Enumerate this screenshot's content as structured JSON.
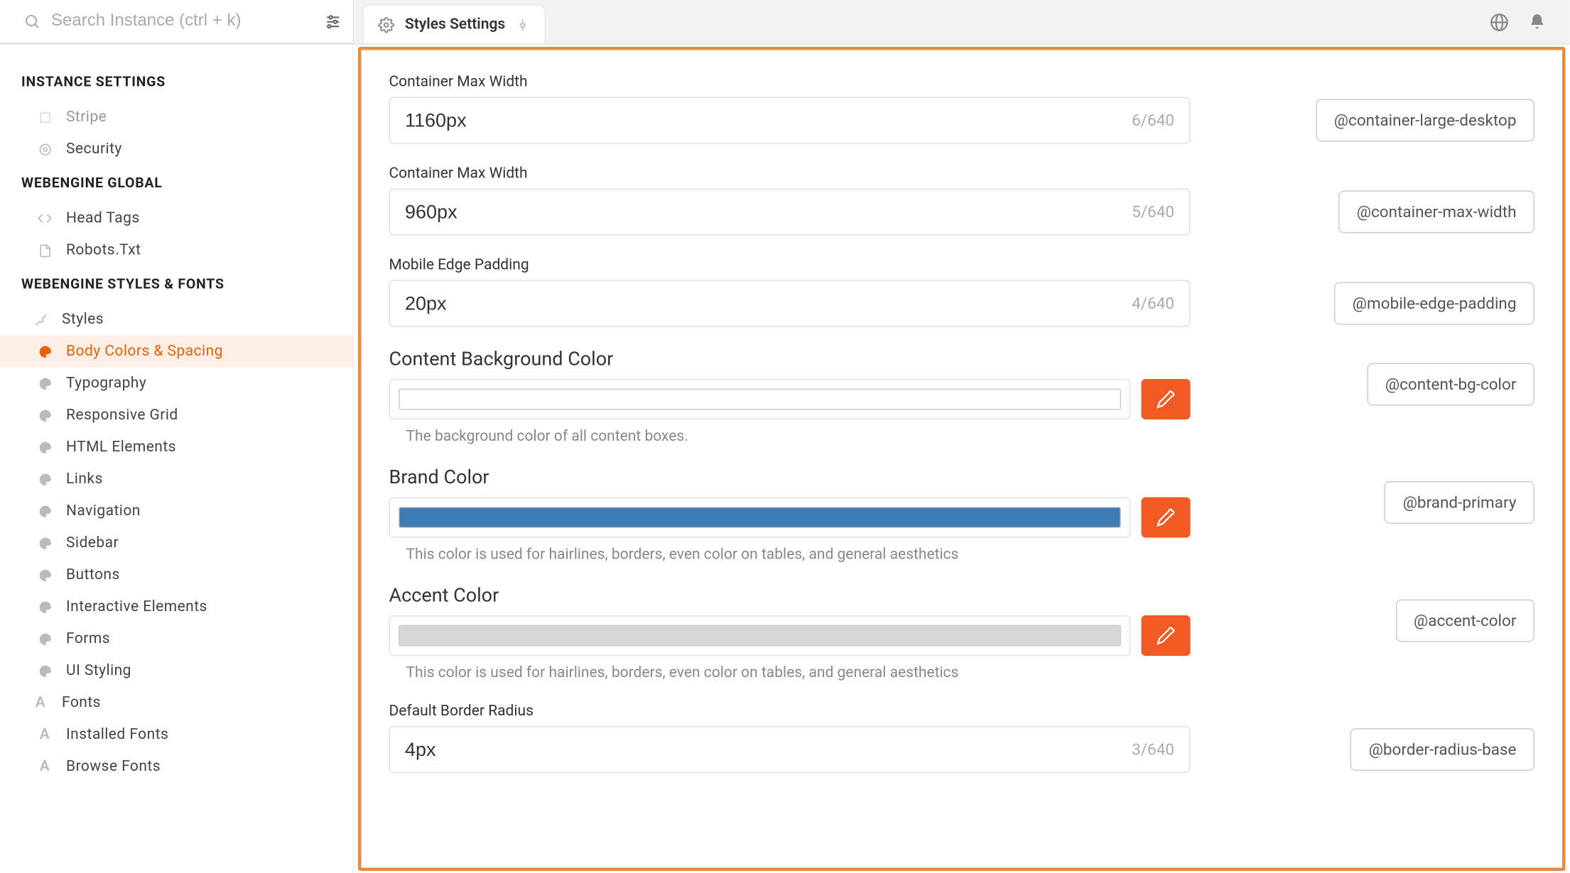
{
  "search": {
    "placeholder": "Search Instance (ctrl + k)"
  },
  "tab": {
    "label": "Styles Settings"
  },
  "sidebar": {
    "sectionA": "INSTANCE SETTINGS",
    "itemsA": [
      {
        "label": "Stripe"
      },
      {
        "label": "Security"
      }
    ],
    "sectionB": "WEBENGINE GLOBAL",
    "itemsB": [
      {
        "label": "Head Tags"
      },
      {
        "label": "Robots.Txt"
      }
    ],
    "sectionC": "WEBENGINE STYLES & FONTS",
    "stylesLabel": "Styles",
    "styleSub": [
      {
        "label": "Body Colors & Spacing",
        "active": true
      },
      {
        "label": "Typography"
      },
      {
        "label": "Responsive Grid"
      },
      {
        "label": "HTML Elements"
      },
      {
        "label": "Links"
      },
      {
        "label": "Navigation"
      },
      {
        "label": "Sidebar"
      },
      {
        "label": "Buttons"
      },
      {
        "label": "Interactive Elements"
      },
      {
        "label": "Forms"
      },
      {
        "label": "UI Styling"
      }
    ],
    "fontsLabel": "Fonts",
    "fontsSub": [
      {
        "label": "Installed Fonts"
      },
      {
        "label": "Browse Fonts"
      }
    ]
  },
  "fields": {
    "f0": {
      "label": "Container Max Width",
      "value": "1160px",
      "counter": "6/640",
      "varname": "@container-large-desktop"
    },
    "f1": {
      "label": "Container Max Width",
      "value": "960px",
      "counter": "5/640",
      "varname": "@container-max-width"
    },
    "f2": {
      "label": "Mobile Edge Padding",
      "value": "20px",
      "counter": "4/640",
      "varname": "@mobile-edge-padding"
    },
    "f3": {
      "label": "Content Background Color",
      "color": "#ffffff",
      "help": "The background color of all content boxes.",
      "varname": "@content-bg-color"
    },
    "f4": {
      "label": "Brand Color",
      "color": "#3e7bb3",
      "help": "This color is used for hairlines, borders, even color on tables, and general aesthetics",
      "varname": "@brand-primary"
    },
    "f5": {
      "label": "Accent Color",
      "color": "#d7d7d7",
      "help": "This color is used for hairlines, borders, even color on tables, and general aesthetics",
      "varname": "@accent-color"
    },
    "f6": {
      "label": "Default Border Radius",
      "value": "4px",
      "counter": "3/640",
      "varname": "@border-radius-base"
    }
  }
}
